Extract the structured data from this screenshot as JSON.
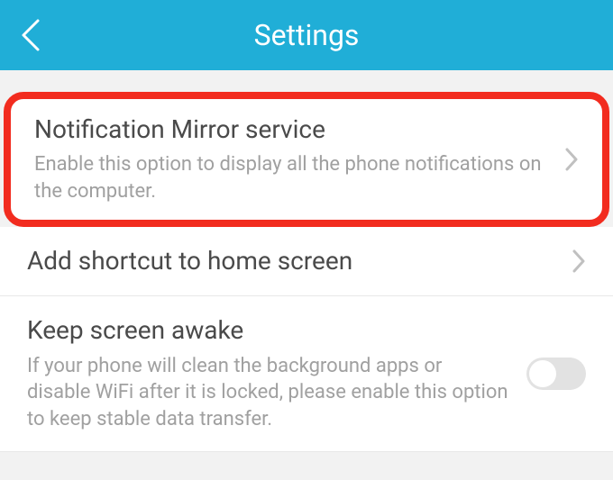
{
  "header": {
    "title": "Settings"
  },
  "items": [
    {
      "title": "Notification Mirror service",
      "desc": "Enable this option to display all the phone notifications on the computer."
    },
    {
      "title": "Add shortcut to home screen"
    },
    {
      "title": "Keep screen awake",
      "desc": "If your phone will clean the background apps or disable WiFi after it is locked, please enable this option to keep stable data transfer."
    }
  ]
}
